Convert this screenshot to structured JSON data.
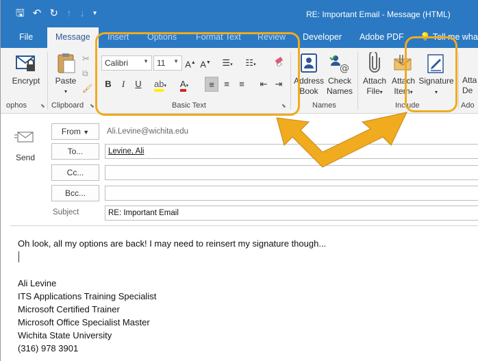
{
  "titlebar": {
    "title": "RE: Important Email  -  Message (HTML)",
    "qat_save": "🖫",
    "qat_undo": "↶",
    "qat_redo": "↻",
    "qat_up": "↑",
    "qat_down": "↓",
    "qat_customize": "▾"
  },
  "tabs": [
    {
      "label": "File"
    },
    {
      "label": "Message"
    },
    {
      "label": "Insert"
    },
    {
      "label": "Options"
    },
    {
      "label": "Format Text"
    },
    {
      "label": "Review"
    },
    {
      "label": "Developer"
    },
    {
      "label": "Adobe PDF"
    },
    {
      "label": "Tell me what"
    }
  ],
  "ribbon": {
    "encrypt": "Encrypt",
    "paste": "Paste",
    "font_name": "Calibri",
    "font_size": "11",
    "bold": "B",
    "italic": "I",
    "underline": "U",
    "address_book_1": "Address",
    "address_book_2": "Book",
    "check_names_1": "Check",
    "check_names_2": "Names",
    "attach_file_1": "Attach",
    "attach_file_2": "File",
    "attach_item_1": "Attach",
    "attach_item_2": "Item",
    "signature": "Signature",
    "groups": {
      "tags_partial": "ophos",
      "clipboard": "Clipboard",
      "basic_text": "Basic Text",
      "names": "Names",
      "include": "Include",
      "adobe_partial": "Ado"
    }
  },
  "compose": {
    "send": "Send",
    "from_label": "From",
    "from_value": "Ali.Levine@wichita.edu",
    "to_label": "To...",
    "to_value": "Levine, Ali",
    "cc_label": "Cc...",
    "cc_value": "",
    "bcc_label": "Bcc...",
    "bcc_value": "",
    "subject_label": "Subject",
    "subject_value": "RE: Important Email"
  },
  "message_body": {
    "first_line": "Oh look, all my options are back! I may need to reinsert my signature though...",
    "signature_lines": [
      "Ali Levine",
      "ITS Applications Training Specialist",
      "Microsoft Certified Trainer",
      "Microsoft Office Specialist Master",
      "Wichita State University",
      "(316) 978 3901"
    ]
  },
  "colors": {
    "title_blue": "#2b79c2",
    "ribbon_bg": "#f3f3f3",
    "callout_orange": "#f0ab1e"
  }
}
